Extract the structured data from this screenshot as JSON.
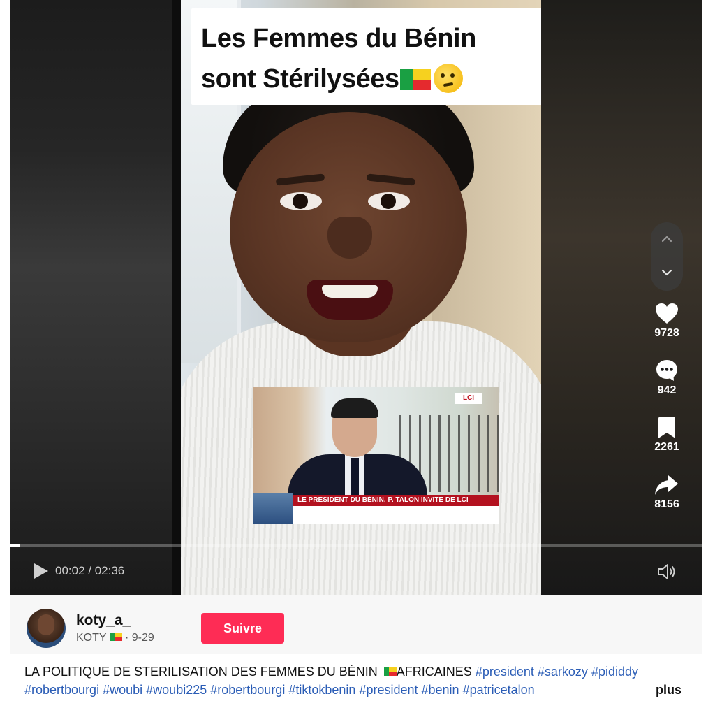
{
  "video": {
    "caption_line1": "Les Femmes du Bénin",
    "caption_line2": "sont Stérilysées",
    "current_time": "00:02",
    "duration": "02:36",
    "progress": 0.013,
    "inset": {
      "channel": "LCI",
      "banner": "LE PRÉSIDENT DU BÉNIN, P. TALON INVITÉ DE LCI"
    }
  },
  "actions": {
    "likes": "9728",
    "comments": "942",
    "saves": "2261",
    "shares": "8156"
  },
  "author": {
    "username": "koty_a_",
    "display_name": "KOTY",
    "date": "9-29",
    "follow_label": "Suivre"
  },
  "description": {
    "title_part1": "LA POLITIQUE DE STERILISATION DES FEMMES DU BÉNIN ",
    "title_part2": "AFRICAINES",
    "hashtags": [
      "#president",
      "#sarkozy",
      "#pididdy",
      "#robertbourgi",
      "#woubi",
      "#woubi225",
      "#robertbourgi",
      "#tiktokbenin",
      "#president",
      "#benin",
      "#patricetalon"
    ],
    "more_label": "plus"
  },
  "colors": {
    "accent": "#fe2c55",
    "hashtag": "#2b5db6",
    "benin_green": "#1aa043",
    "benin_yellow": "#f6d11f",
    "benin_red": "#e52a2e"
  }
}
